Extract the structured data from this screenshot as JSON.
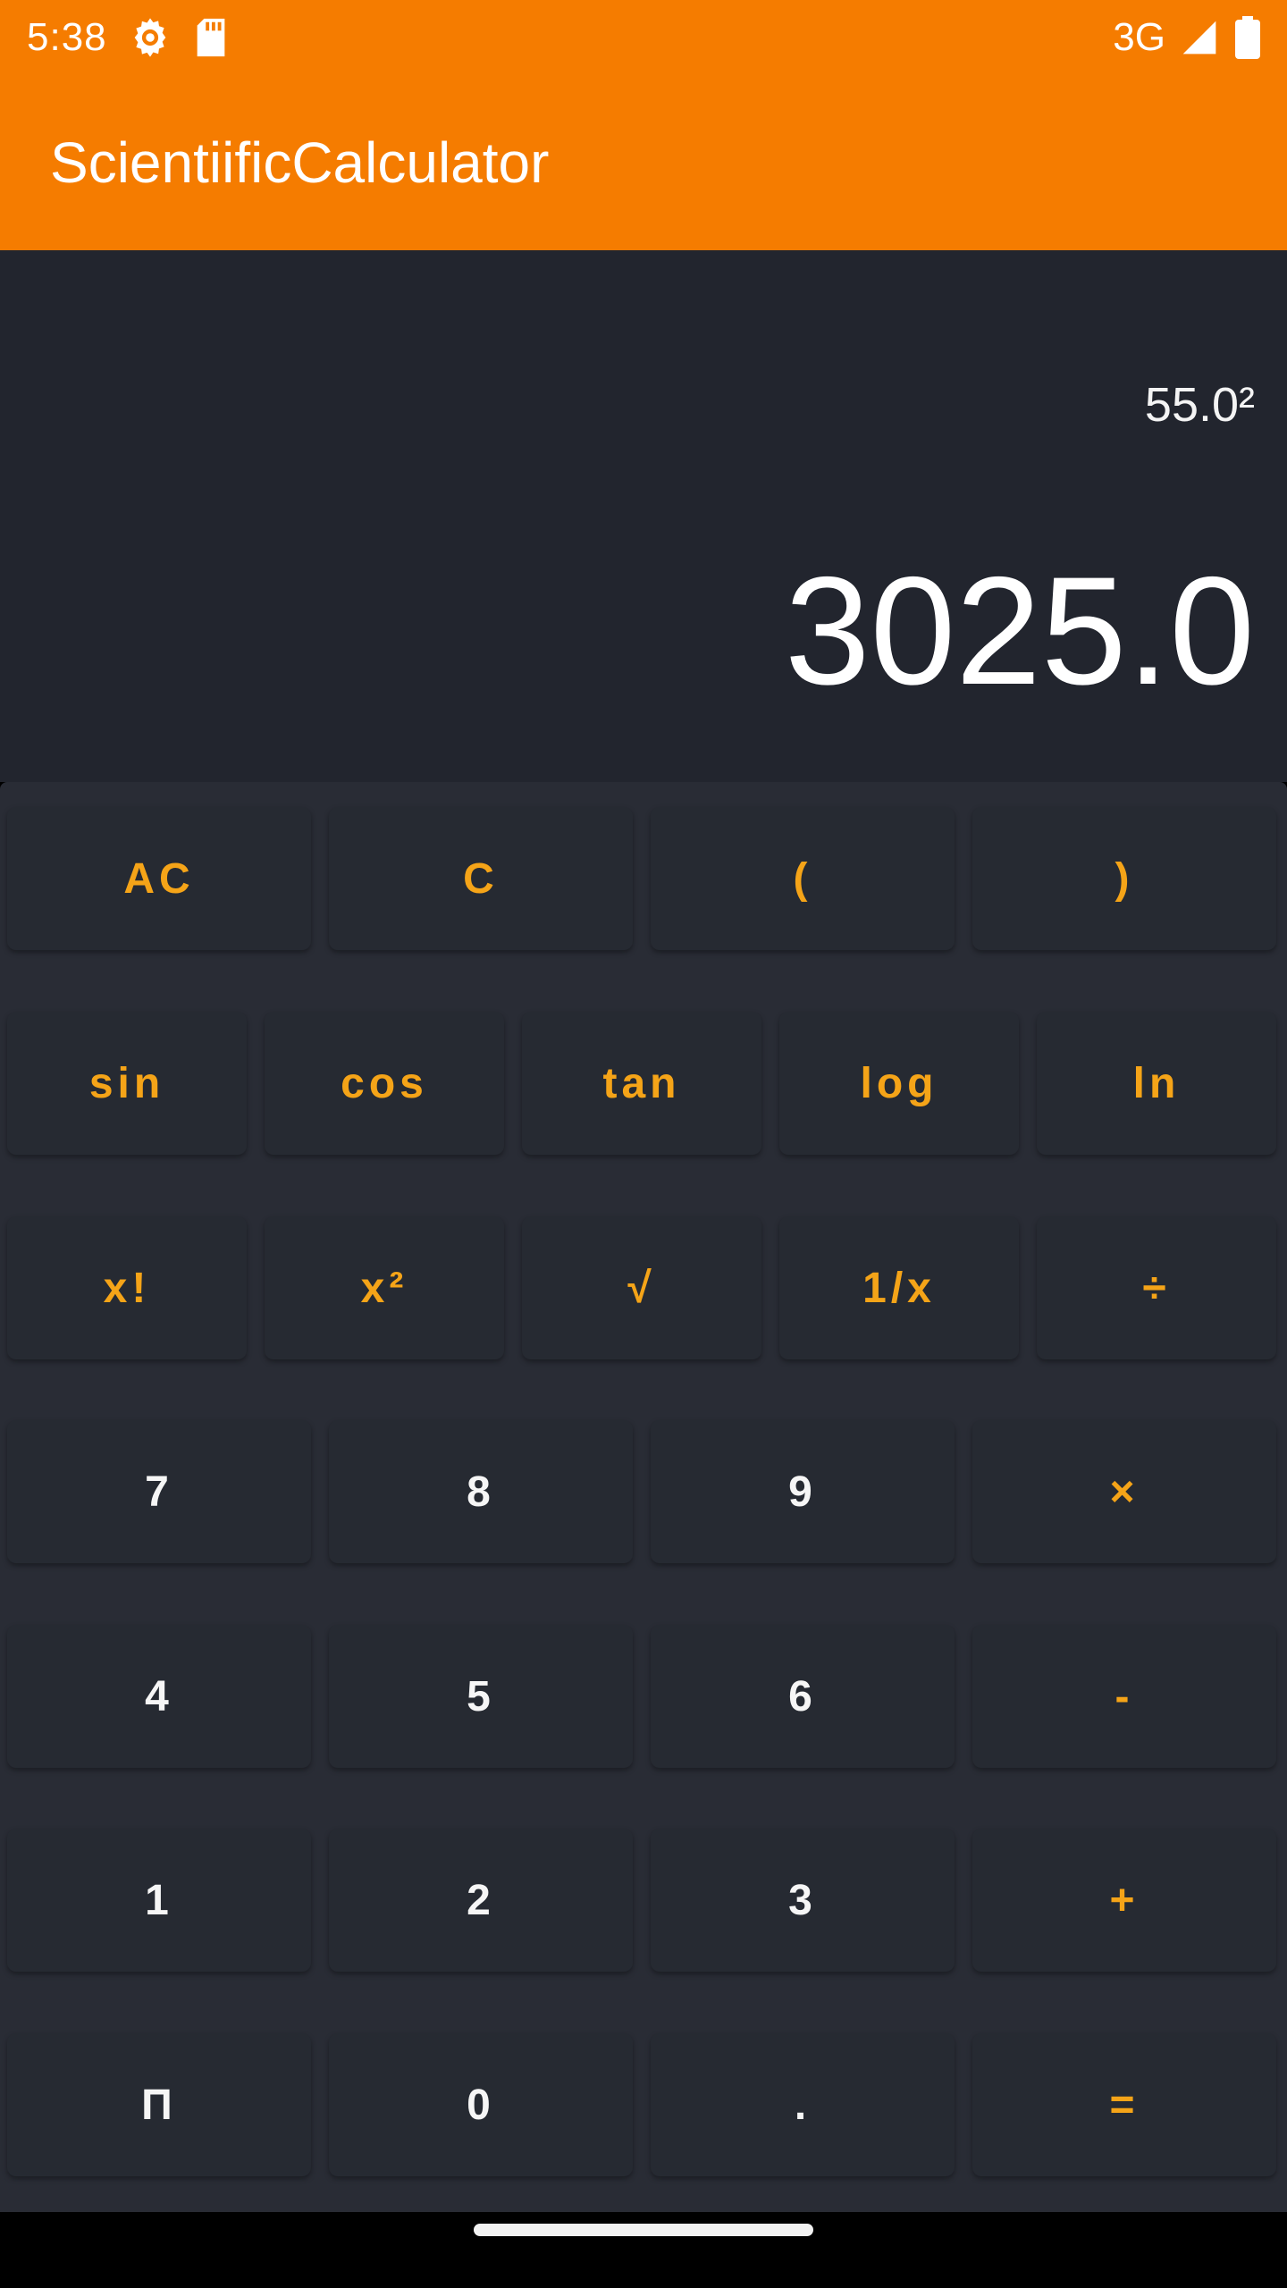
{
  "status_bar": {
    "time": "5:38",
    "left_icons": [
      "settings-gear-icon",
      "sd-card-icon"
    ],
    "network": "3G",
    "right_icons": [
      "signal-icon",
      "battery-icon"
    ]
  },
  "app_bar": {
    "title": "ScientiificCalculator"
  },
  "display": {
    "expression": "55.0²",
    "result": "3025.0"
  },
  "keypad": {
    "row1": [
      "AC",
      "C",
      "(",
      ")"
    ],
    "row2": [
      "sin",
      "cos",
      "tan",
      "log",
      "ln"
    ],
    "row3": [
      "x!",
      "x²",
      "√",
      "1/x",
      "÷"
    ],
    "row4": [
      "7",
      "8",
      "9",
      "×"
    ],
    "row5": [
      "4",
      "5",
      "6",
      "-"
    ],
    "row6": [
      "1",
      "2",
      "3",
      "+"
    ],
    "row7": [
      "Π",
      "0",
      ".",
      "="
    ]
  },
  "colors": {
    "accent": "#f57c00",
    "operator_text": "#f5a418",
    "digit_text": "#f6f6f6",
    "display_bg": "#22252e",
    "keypad_bg": "#292c35",
    "key_bg": "#262a32"
  }
}
